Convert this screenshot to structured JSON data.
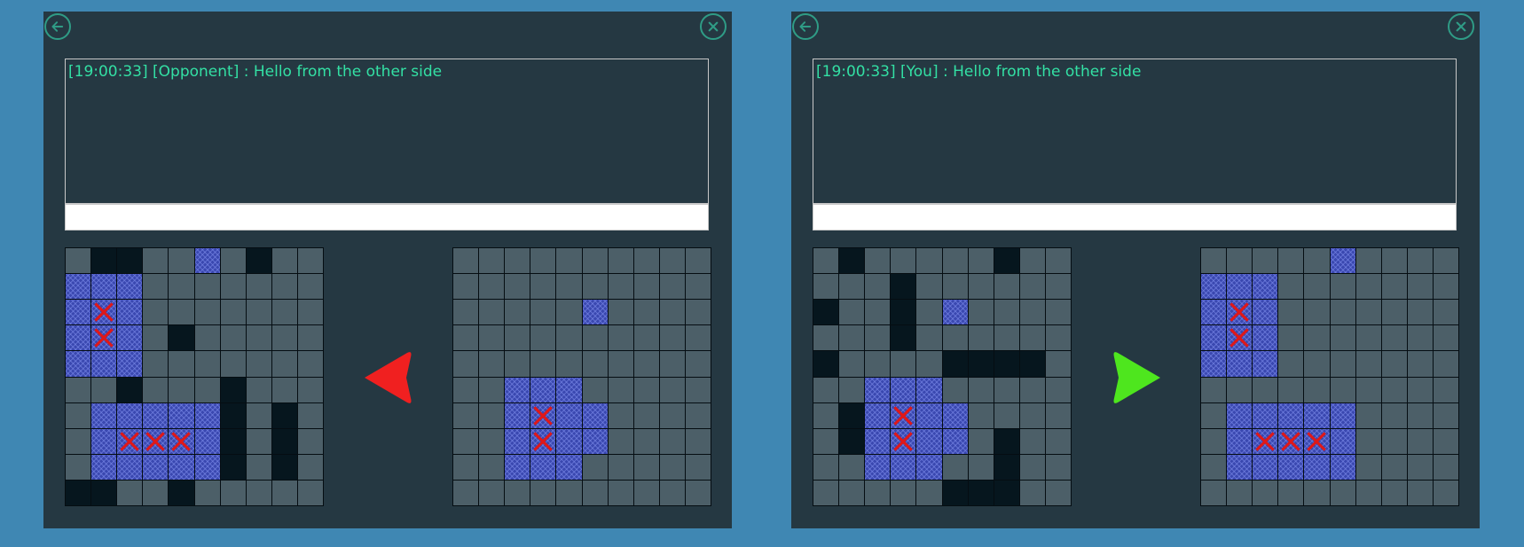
{
  "panels": [
    {
      "chat_message": "[19:00:33] [Opponent] : Hello from the other side",
      "chat_input_value": "",
      "turn_indicator": {
        "direction": "left",
        "color": "#f02020"
      },
      "own_board": [
        "W M M W W S W M W W",
        "S S S W W W W W W W",
        "S X S W W W W W W W",
        "S X S W M W W W W W",
        "S S S W W W W W W W",
        "W W M W W W M W W W",
        "W S S S S S M W M W",
        "W S X X X S M W M W",
        "W S S S S S M W M W",
        "M M W W M W W W W W"
      ],
      "target_board": [
        "W W W W W W W W W W",
        "W W W W W W W W W W",
        "W W W W W S W W W W",
        "W W W W W W W W W W",
        "W W W W W W W W W W",
        "W W S S S W W W W W",
        "W W S X S S W W W W",
        "W W S X S S W W W W",
        "W W S S S W W W W W",
        "W W W W W W W W W W"
      ]
    },
    {
      "chat_message": "[19:00:33] [You] : Hello from the other side",
      "chat_input_value": "",
      "turn_indicator": {
        "direction": "right",
        "color": "#4ee61e"
      },
      "own_board": [
        "W M W W W W W M W W",
        "W W W M W W W W W W",
        "M W W M W S W W W W",
        "W W W M W W W W W W",
        "M W W W W M M M M W",
        "W W S S S W W W W W",
        "W M S X S S W W W W",
        "W M S X S S W M W W",
        "W W S S S W W M W W",
        "W W W W W M M M W W"
      ],
      "target_board": [
        "W W W W W S W W W W",
        "S S S W W W W W W W",
        "S X S W W W W W W W",
        "S X S W W W W W W W",
        "S S S W W W W W W W",
        "W W W W W W W W W W",
        "W S S S S S W W W W",
        "W S X X X S W W W W",
        "W S S S S S W W W W",
        "W W W W W W W W W W"
      ]
    }
  ],
  "icons": {
    "back": "arrow-left-icon",
    "close": "close-x-icon"
  },
  "colors": {
    "background": "#3f87b3",
    "panel": "#253842",
    "accent": "#2f9c86",
    "chat_text": "#33e0a4",
    "water": "#4c5f68",
    "miss": "#06161e",
    "ship": "#3a48b0",
    "hit_mark": "#e01818"
  }
}
